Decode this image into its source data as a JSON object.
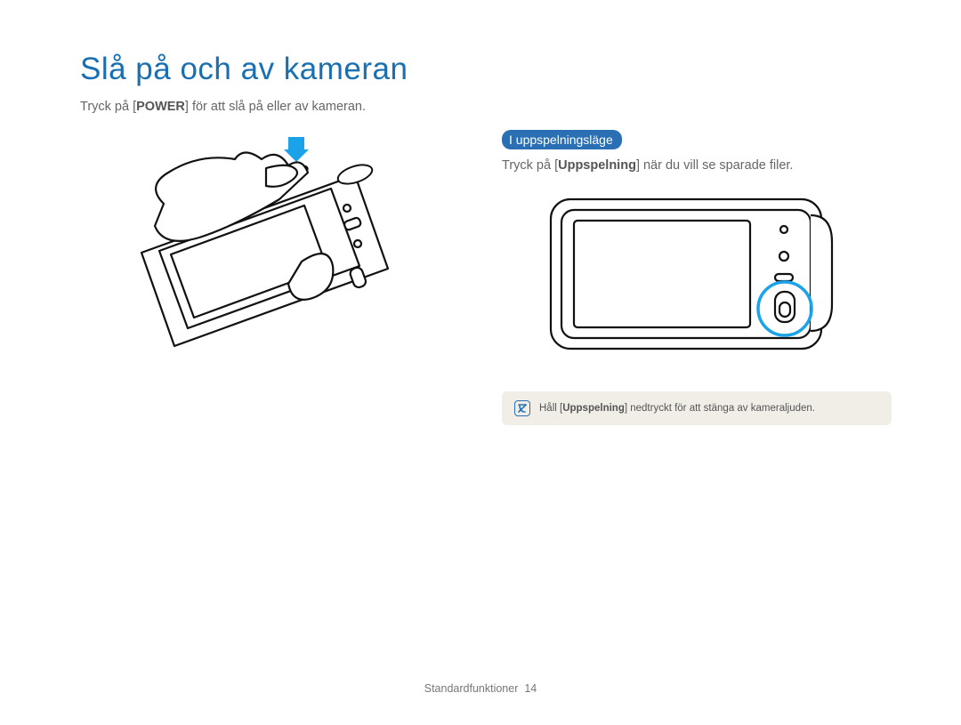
{
  "title": "Slå på och av kameran",
  "intro": {
    "prefix": "Tryck på [",
    "key": "POWER",
    "suffix": "] för att slå på eller av kameran."
  },
  "playback": {
    "heading": "I uppspelningsläge",
    "prefix": "Tryck på [",
    "key": "Uppspelning",
    "suffix": "] när du vill se sparade ﬁler."
  },
  "note": {
    "prefix": "Håll [",
    "key": "Uppspelning",
    "suffix": "] nedtryckt för att stänga av kameraljuden."
  },
  "footer": {
    "label": "Standardfunktioner",
    "page": "14"
  }
}
